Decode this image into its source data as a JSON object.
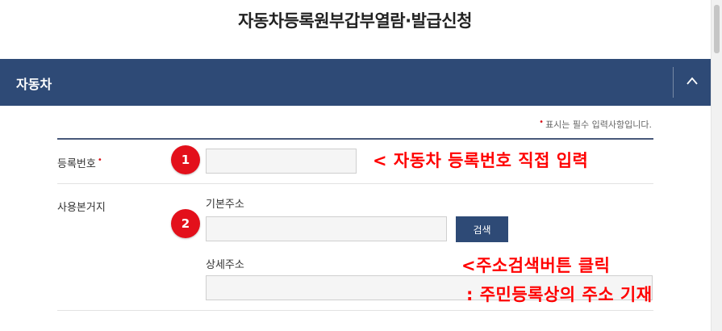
{
  "page": {
    "title": "자동차등록원부갑부열람·발급신청"
  },
  "section": {
    "title": "자동차"
  },
  "required_note": {
    "marker": "•",
    "text": "표시는 필수 입력사항입니다."
  },
  "form": {
    "registration_number": {
      "label": "등록번호",
      "required_marker": "•",
      "value": "",
      "placeholder": ""
    },
    "residence": {
      "label": "사용본거지",
      "base_address_label": "기본주소",
      "base_address_value": "",
      "search_button": "검색",
      "detail_address_label": "상세주소",
      "detail_address_value": ""
    }
  },
  "annotations": {
    "badge1": "1",
    "badge2": "2",
    "note1": "< 자동차 등록번호 직접 입력",
    "note2_line1": "<주소검색버튼 클릭",
    "note2_line2": ": 주민등록상의 주소 기재"
  },
  "colors": {
    "navy": "#2e4a76",
    "red": "#e3101b",
    "annotation_red": "#ff0000"
  }
}
